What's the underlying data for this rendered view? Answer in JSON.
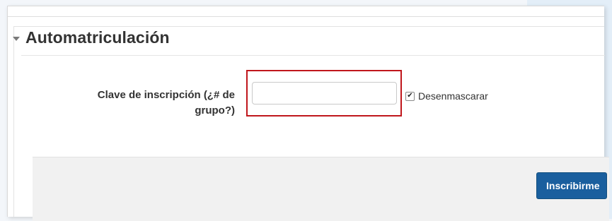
{
  "section": {
    "title": "Automatriculación",
    "collapse_icon": "caret-down-icon"
  },
  "form": {
    "key_label_line1": "Clave de inscripción (¿# de",
    "key_label_line2": "grupo?)",
    "key_input_value": "",
    "unmask_checked": true,
    "unmask_label": "Desenmascarar",
    "submit_label": "Inscribirme"
  },
  "colors": {
    "highlight": "#c0161c",
    "button": "#1a5f9e"
  }
}
